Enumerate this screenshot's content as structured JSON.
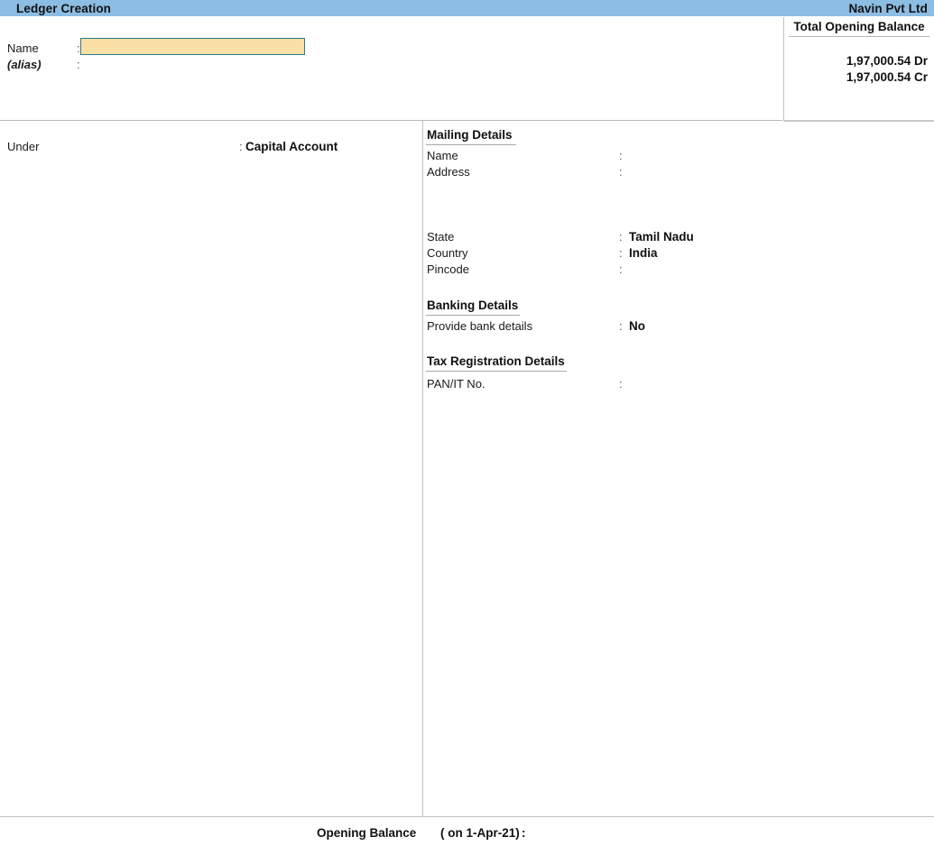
{
  "titlebar": {
    "screen_title": "Ledger Creation",
    "company_name": "Navin Pvt Ltd"
  },
  "top_form": {
    "name_label": "Name",
    "name_colon": ":",
    "name_value": "",
    "name_placeholder": "",
    "alias_label": "(alias)",
    "alias_colon": ":",
    "alias_value": ""
  },
  "total_opening_balance": {
    "title": "Total Opening Balance",
    "debit": "1,97,000.54 Dr",
    "credit": "1,97,000.54 Cr"
  },
  "left_panel": {
    "under_label": "Under",
    "under_colon": ":",
    "under_value": "Capital Account"
  },
  "mailing_details": {
    "heading": "Mailing Details",
    "rows": [
      {
        "label": "Name",
        "colon": ":",
        "value": ""
      },
      {
        "label": "Address",
        "colon": ":",
        "value": ""
      },
      {
        "label": "State",
        "colon": ":",
        "value": "Tamil Nadu"
      },
      {
        "label": "Country",
        "colon": ":",
        "value": "India"
      },
      {
        "label": "Pincode",
        "colon": ":",
        "value": ""
      }
    ]
  },
  "banking_details": {
    "heading": "Banking Details",
    "rows": [
      {
        "label": "Provide bank details",
        "colon": ":",
        "value": "No"
      }
    ]
  },
  "tax_registration_details": {
    "heading": "Tax Registration Details",
    "rows": [
      {
        "label": "PAN/IT No.",
        "colon": ":",
        "value": ""
      }
    ]
  },
  "footer": {
    "opening_balance_label": "Opening Balance",
    "opening_balance_date": "( on 1-Apr-21)",
    "opening_balance_colon": ":",
    "opening_balance_value": ""
  },
  "colors": {
    "titlebar_blue": "#8cbde3",
    "input_highlight": "#fadfa6",
    "input_border": "#2f7b85",
    "divider": "#c0c0c0"
  }
}
